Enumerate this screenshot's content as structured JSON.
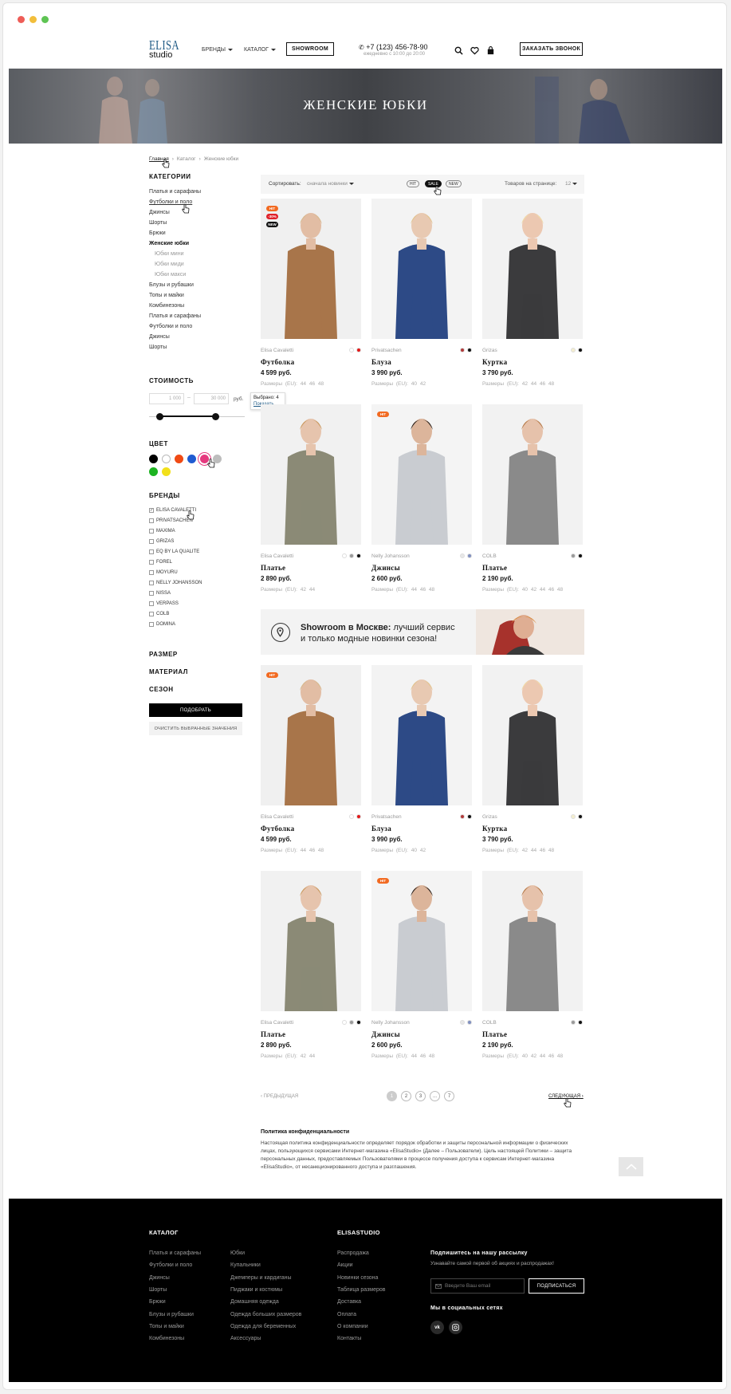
{
  "window": {
    "dot_colors": [
      "#ee5d57",
      "#f2be3b",
      "#5ec453"
    ]
  },
  "header": {
    "logo_top": "ELISA",
    "logo_bottom": "studio",
    "nav_brands": "БРЕНДЫ",
    "nav_catalog": "КАТАЛОГ",
    "showroom": "SHOWROOM",
    "phone": "+7 (123) 456-78-90",
    "phone_hours": "ежедневно с 10:00 до 20:00",
    "callback": "ЗАКАЗАТЬ ЗВОНОК",
    "icons": [
      "search-icon",
      "heart-icon",
      "bag-icon"
    ]
  },
  "banner": {
    "title": "ЖЕНСКИЕ ЮБКИ"
  },
  "breadcrumb": {
    "home": "Главная",
    "sep": "›",
    "catalog": "Каталог",
    "current": "Женские юбки"
  },
  "sidebar": {
    "categories_title": "КАТЕГОРИИ",
    "categories": [
      {
        "label": "Платья и сарафаны"
      },
      {
        "label": "Футболки и поло"
      },
      {
        "label": "Джинсы"
      },
      {
        "label": "Шорты"
      },
      {
        "label": "Брюки"
      },
      {
        "label": "Женские юбки",
        "active": true
      },
      {
        "label": "Юбки мини",
        "sub": true
      },
      {
        "label": "Юбки миди",
        "sub": true
      },
      {
        "label": "Юбки макси",
        "sub": true
      },
      {
        "label": "Блузы и рубашки"
      },
      {
        "label": "Топы и майки"
      },
      {
        "label": "Комбинезоны"
      },
      {
        "label": "Платья и сарафаны"
      },
      {
        "label": "Футболки и поло"
      },
      {
        "label": "Джинсы"
      },
      {
        "label": "Шорты"
      }
    ],
    "price_title": "СТОИМОСТЬ",
    "price_from": "1 000",
    "price_dash": "–",
    "price_to": "30 000",
    "price_currency": "руб.",
    "tooltip_selected": "Выбрано: 4",
    "tooltip_show": "Показать",
    "color_title": "ЦВЕТ",
    "colors": [
      "#000000",
      "#ffffff",
      "#f04a14",
      "#1f5bd1",
      "#e5397e",
      "#bdbdbd",
      "#1db321",
      "#f2e01b"
    ],
    "brands_title": "БРЕНДЫ",
    "brands": [
      {
        "label": "ELISA CAVALETTI",
        "checked": true
      },
      {
        "label": "PRIVATSACHEN"
      },
      {
        "label": "MAXIMA"
      },
      {
        "label": "GRIZAS"
      },
      {
        "label": "EQ BY LA QUALITE"
      },
      {
        "label": "FOREL"
      },
      {
        "label": "MOYURU"
      },
      {
        "label": "NELLY JOHANSSON"
      },
      {
        "label": "NISSA"
      },
      {
        "label": "VERPASS"
      },
      {
        "label": "COLB"
      },
      {
        "label": "DOMINA"
      }
    ],
    "size_title": "РАЗМЕР",
    "material_title": "МАТЕРИАЛ",
    "season_title": "СЕЗОН",
    "apply": "ПОДОБРАТЬ",
    "clear": "ОЧИСТИТЬ ВЫБРАННЫЕ ЗНАЧЕНИЯ"
  },
  "sortbar": {
    "sort_label": "Сортировать:",
    "sort_value": "сначала новинки",
    "pills": [
      "HIT",
      "SALE",
      "NEW"
    ],
    "per_page_label": "Товаров на странице:",
    "per_page_value": "12"
  },
  "products": [
    {
      "brand": "Elisa Cavaletti",
      "name": "Футболка",
      "price": "4 599 руб.",
      "sizes": "Размеры (EU):  44  46  48",
      "colors": [
        "#ffffff",
        "#e31818"
      ],
      "badges": [
        "HIT",
        "-30%",
        "NEW"
      ]
    },
    {
      "brand": "Privatsachen",
      "name": "Блуза",
      "price": "3 990 руб.",
      "sizes": "Размеры (EU):  40  42",
      "colors": [
        "#b23a3a",
        "#111111"
      ],
      "badges": []
    },
    {
      "brand": "Grizas",
      "name": "Куртка",
      "price": "3 790 руб.",
      "sizes": "Размеры (EU):  42  44  46  48",
      "colors": [
        "#f4eecf",
        "#111111"
      ],
      "badges": []
    },
    {
      "brand": "Elisa Cavaletti",
      "name": "Платье",
      "price": "2 890 руб.",
      "sizes": "Размеры (EU):  42  44",
      "colors": [
        "#ffffff",
        "#9a9a9a",
        "#111111"
      ],
      "badges": []
    },
    {
      "brand": "Nelly Johansson",
      "name": "Джинсы",
      "price": "2 600 руб.",
      "sizes": "Размеры (EU):  44  46  48",
      "colors": [
        "#e8e8e8",
        "#7f8fc0"
      ],
      "badges": [
        "HIT"
      ]
    },
    {
      "brand": "COLB",
      "name": "Платье",
      "price": "2 190 руб.",
      "sizes": "Размеры (EU):  40  42  44  46  48",
      "colors": [
        "#9a9a9a",
        "#111111"
      ],
      "badges": []
    },
    {
      "brand": "Elisa Cavaletti",
      "name": "Футболка",
      "price": "4 599 руб.",
      "sizes": "Размеры (EU):  44  46  48",
      "colors": [
        "#ffffff",
        "#e31818"
      ],
      "badges": [
        "HIT"
      ]
    },
    {
      "brand": "Privatsachen",
      "name": "Блуза",
      "price": "3 990 руб.",
      "sizes": "Размеры (EU):  40  42",
      "colors": [
        "#b23a3a",
        "#111111"
      ],
      "badges": []
    },
    {
      "brand": "Grizas",
      "name": "Куртка",
      "price": "3 790 руб.",
      "sizes": "Размеры (EU):  42  44  46  48",
      "colors": [
        "#f4eecf",
        "#111111"
      ],
      "badges": []
    },
    {
      "brand": "Elisa Cavaletti",
      "name": "Платье",
      "price": "2 890 руб.",
      "sizes": "Размеры (EU):  42  44",
      "colors": [
        "#ffffff",
        "#9a9a9a",
        "#111111"
      ],
      "badges": []
    },
    {
      "brand": "Nelly Johansson",
      "name": "Джинсы",
      "price": "2 600 руб.",
      "sizes": "Размеры (EU):  44  46  48",
      "colors": [
        "#e8e8e8",
        "#7f8fc0"
      ],
      "badges": [
        "HIT"
      ]
    },
    {
      "brand": "COLB",
      "name": "Платье",
      "price": "2 190 руб.",
      "sizes": "Размеры (EU):  40  42  44  46  48",
      "colors": [
        "#9a9a9a",
        "#111111"
      ],
      "badges": []
    }
  ],
  "promo": {
    "bold": "Showroom в Москве:",
    "rest": " лучший сервис",
    "line2": "и только модные новинки сезона!"
  },
  "pagination": {
    "prev": "ПРЕДЫДУЩАЯ",
    "pages": [
      "1",
      "2",
      "3",
      "...",
      "7"
    ],
    "next": "СЛЕДУЮЩАЯ"
  },
  "policy": {
    "title": "Политика конфиденциальности",
    "text": "Настоящая политика конфиденциальности определяет порядок обработки и защиты персональной информации о физических лицах, пользующихся сервисами Интернет-магазина «ElisaStudio» (Далее – Пользователи). Цель настоящей Политики – защита персональных данных,  предоставляемых Пользователями в процессе получения доступа к сервисам Интернет-магазина «ElisaStudio», от несанкционированного доступа и разглашения."
  },
  "footer": {
    "catalog_title": "КАТАЛОГ",
    "catalog_col1": [
      "Платья и сарафаны",
      "Футболки и поло",
      "Джинсы",
      "Шорты",
      "Брюки",
      "Блузы и рубашки",
      "Топы и майки",
      "Комбинезоны"
    ],
    "catalog_col2": [
      "Юбки",
      "Купальники",
      "Джемперы и кардиганы",
      "Пиджаки и костюмы",
      "Домашняя одежда",
      "Одежда больших размеров",
      "Одежда для беременных",
      "Аксессуары"
    ],
    "studio_title": "ELISASTUDIO",
    "studio_links": [
      "Распродажа",
      "Акции",
      "Новинки сезона",
      "Таблица размеров",
      "Доставка",
      "Оплата",
      "О компании",
      "Контакты"
    ],
    "subscribe_title": "Подпишитесь на нашу рассылку",
    "subscribe_sub": "Узнавайте самой первой об акциях и распродажах!",
    "email_placeholder": "Введите Ваш email",
    "subscribe_btn": "ПОДПИСАТЬСЯ",
    "social_title": "Мы в социальных сетях",
    "social": [
      "vk",
      "instagram"
    ]
  }
}
